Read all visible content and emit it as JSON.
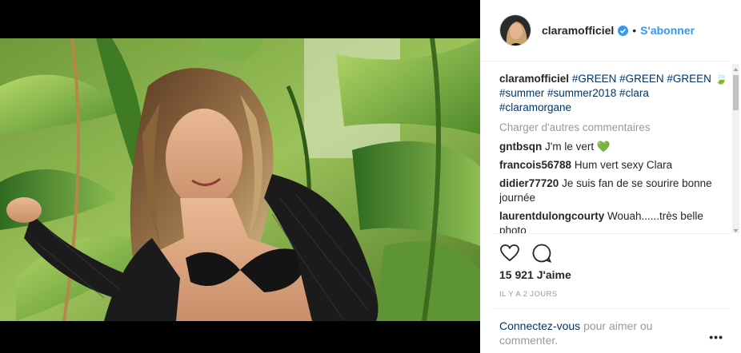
{
  "header": {
    "username": "claramofficiel",
    "separator": "•",
    "follow_label": "S'abonner"
  },
  "caption": {
    "username": "claramofficiel",
    "tags_line1": "#GREEN #GREEN #GREEN",
    "emoji": "🍃",
    "tags_line2": "#summer #summer2018 #clara",
    "tags_line3": "#claramorgane"
  },
  "load_more_label": "Charger d'autres commentaires",
  "comments": [
    {
      "user": "gntbsqn",
      "text": "J'm le vert 💚"
    },
    {
      "user": "francois56788",
      "text": "Hum vert sexy Clara"
    },
    {
      "user": "didier77720",
      "text": "Je suis fan de se sourire bonne journée"
    },
    {
      "user": "laurentdulongcourty",
      "text": "Wouah......très belle photo"
    }
  ],
  "likes": "15 921 J'aime",
  "time": "IL Y A 2 JOURS",
  "login": {
    "link": "Connectez-vous",
    "text": "pour aimer ou commenter."
  },
  "more_label": "•••",
  "icons": {
    "like": "heart-icon",
    "comment": "comment-bubble-icon",
    "verified": "verified-badge-icon"
  },
  "colors": {
    "link_blue": "#3897f0",
    "hashtag": "#003569",
    "muted": "#999999"
  }
}
